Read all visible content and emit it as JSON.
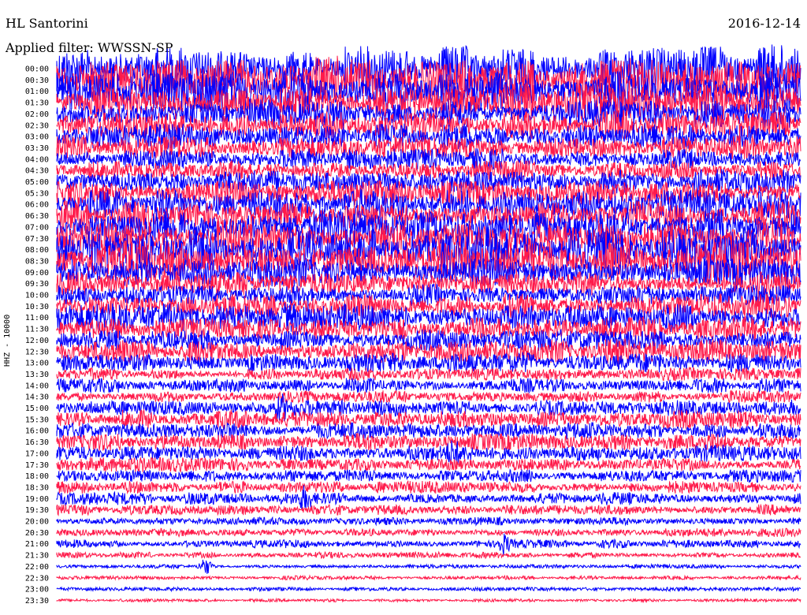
{
  "header": {
    "station": "HL Santorini",
    "date": "2016-12-14",
    "filter": "Applied filter: WWSSN-SP"
  },
  "chart_data": {
    "type": "line",
    "title": "HL Santorini",
    "ylabel": "HHZ - 10000",
    "row_labels": [
      "00:00",
      "00:30",
      "01:00",
      "01:30",
      "02:00",
      "02:30",
      "03:00",
      "03:30",
      "04:00",
      "04:30",
      "05:00",
      "05:30",
      "06:00",
      "06:30",
      "07:00",
      "07:30",
      "08:00",
      "08:30",
      "09:00",
      "09:30",
      "10:00",
      "10:30",
      "11:00",
      "11:30",
      "12:00",
      "12:30",
      "13:00",
      "13:30",
      "14:00",
      "14:30",
      "15:00",
      "15:30",
      "16:00",
      "16:30",
      "17:00",
      "17:30",
      "18:00",
      "18:30",
      "19:00",
      "19:30",
      "20:00",
      "20:30",
      "21:00",
      "21:30",
      "22:00",
      "22:30",
      "23:00",
      "23:30"
    ],
    "series_colors": [
      "#0000ff",
      "#ff1a4a"
    ],
    "amplitude_scale": [
      22,
      22,
      20,
      18,
      14,
      14,
      13,
      12,
      10,
      10,
      12,
      12,
      14,
      14,
      18,
      18,
      20,
      20,
      14,
      12,
      10,
      12,
      14,
      12,
      10,
      12,
      10,
      6,
      7,
      6,
      8,
      9,
      8,
      9,
      8,
      7,
      6,
      6,
      6,
      5,
      4,
      4,
      4,
      3,
      2,
      2,
      2,
      1.5
    ],
    "events": [
      {
        "row": 30,
        "minute": 9
      },
      {
        "row": 34,
        "minute": 16
      },
      {
        "row": 38,
        "minute": 10
      },
      {
        "row": 42,
        "minute": 18
      },
      {
        "row": 44,
        "minute": 6
      }
    ]
  }
}
